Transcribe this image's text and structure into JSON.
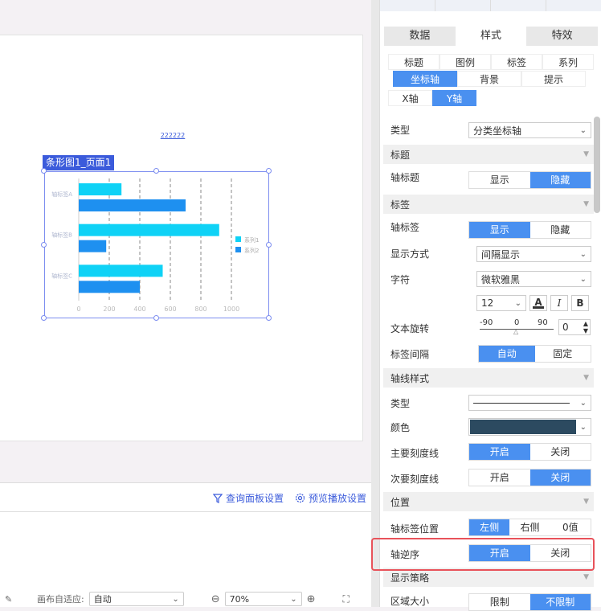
{
  "canvas": {
    "chart_label": "条形图1_页面1",
    "title_text": "222222"
  },
  "chart_data": {
    "type": "bar",
    "orientation": "horizontal",
    "categories": [
      "轴标签A",
      "轴标签B",
      "轴标签C"
    ],
    "series": [
      {
        "name": "系列1",
        "values": [
          280,
          920,
          550
        ],
        "color": "#0fd2f6"
      },
      {
        "name": "系列2",
        "values": [
          700,
          180,
          400
        ],
        "color": "#1e90f0"
      }
    ],
    "xlim": [
      0,
      1000
    ],
    "x_ticks": [
      "0",
      "200",
      "400",
      "600",
      "800",
      "1000"
    ],
    "grid": "dashed-vertical",
    "legend": "right"
  },
  "bottom": {
    "query_panel": "查询面板设置",
    "preview_settings": "预览播放设置",
    "canvas_adapt_label": "画布自适应:",
    "canvas_adapt_value": "自动",
    "zoom_value": "70%"
  },
  "panel": {
    "main_tabs": [
      "数据",
      "样式",
      "特效"
    ],
    "sub_tabs_row1": [
      "标题",
      "图例",
      "标签",
      "系列"
    ],
    "sub_tabs_row2": [
      "坐标轴",
      "背景",
      "提示"
    ],
    "axis_tabs": [
      "X轴",
      "Y轴"
    ],
    "type_label": "类型",
    "type_value": "分类坐标轴",
    "section_title": "标题",
    "axis_title_label": "轴标题",
    "show": "显示",
    "hide": "隐藏",
    "section_label": "标签",
    "axis_label_label": "轴标签",
    "display_mode_label": "显示方式",
    "display_mode_value": "间隔显示",
    "font_label": "字符",
    "font_value": "微软雅黑",
    "font_size": "12",
    "bold": "B",
    "italic": "I",
    "color_a": "A",
    "rotate_label": "文本旋转",
    "rotate_min": "-90",
    "rotate_mid": "0",
    "rotate_max": "90",
    "rotate_value": "0",
    "interval_label": "标签间隔",
    "auto": "自动",
    "fixed": "固定",
    "section_axisline": "轴线样式",
    "line_type_label": "类型",
    "line_color_label": "颜色",
    "line_color": "#2c4a60",
    "major_tick_label": "主要刻度线",
    "minor_tick_label": "次要刻度线",
    "open": "开启",
    "close": "关闭",
    "section_position": "位置",
    "axis_label_pos_label": "轴标签位置",
    "left": "左侧",
    "right": "右侧",
    "zero": "0值",
    "reverse_label": "轴逆序",
    "section_strategy": "显示策略",
    "area_size_label": "区域大小",
    "limit": "限制",
    "no_limit": "不限制"
  }
}
